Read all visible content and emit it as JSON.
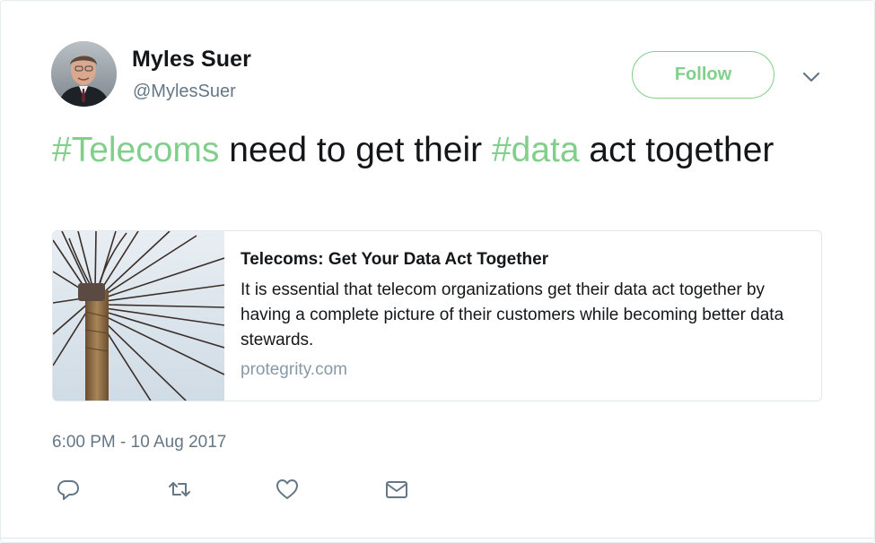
{
  "author": {
    "name": "Myles Suer",
    "handle": "@MylesSuer",
    "avatar_icon": "profile-photo"
  },
  "follow_button": {
    "label": "Follow",
    "color": "#80cf8a"
  },
  "more_menu": {
    "icon": "chevron-down-icon"
  },
  "tweet": {
    "segments": [
      {
        "text": "#Telecoms",
        "hashtag": true
      },
      {
        "text": " need to get their ",
        "hashtag": false
      },
      {
        "text": "#data",
        "hashtag": true
      },
      {
        "text": " act together",
        "hashtag": false
      }
    ]
  },
  "card": {
    "title": "Telecoms: Get Your Data Act Together",
    "description": "It is essential that telecom organizations get their data act together by having a complete picture of their customers while becoming better data stewards.",
    "domain": "protegrity.com",
    "image_icon": "telephone-pole-wires-image"
  },
  "timestamp": "6:00 PM - 10 Aug 2017",
  "actions": [
    {
      "name": "reply-icon"
    },
    {
      "name": "retweet-icon"
    },
    {
      "name": "like-icon"
    },
    {
      "name": "direct-message-icon"
    }
  ],
  "colors": {
    "accent": "#80cf8a",
    "text": "#14171a",
    "muted": "#657786",
    "border": "#e1e8ed"
  }
}
